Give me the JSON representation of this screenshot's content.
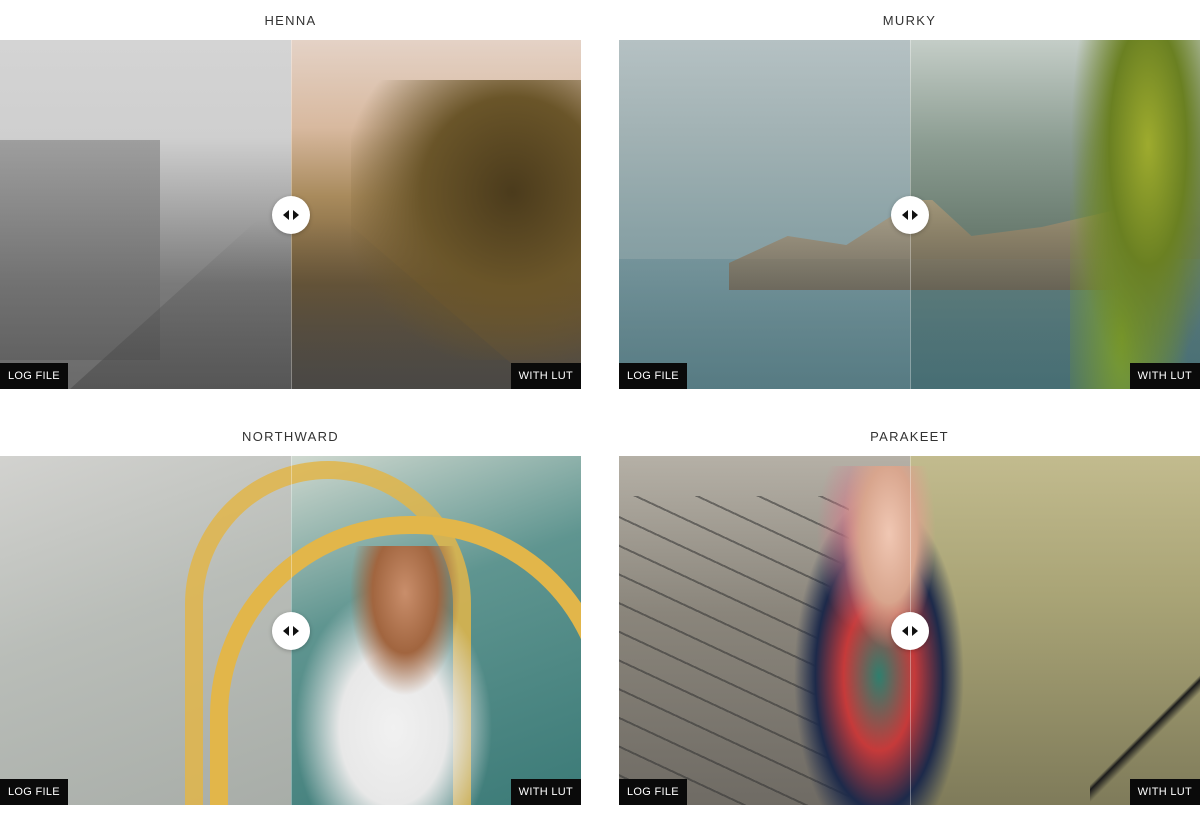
{
  "cards": [
    {
      "title": "HENNA",
      "left_label": "LOG FILE",
      "right_label": "WITH LUT"
    },
    {
      "title": "MURKY",
      "left_label": "LOG FILE",
      "right_label": "WITH LUT"
    },
    {
      "title": "NORTHWARD",
      "left_label": "LOG FILE",
      "right_label": "WITH LUT"
    },
    {
      "title": "PARAKEET",
      "left_label": "LOG FILE",
      "right_label": "WITH LUT"
    }
  ],
  "icons": {
    "handle": "left-right-arrows-icon"
  },
  "colors": {
    "tag_background": "#0a0a0a",
    "tag_text": "#ffffff",
    "title_text": "#333333",
    "handle_background": "#ffffff"
  },
  "slider_position_fraction": 0.5
}
